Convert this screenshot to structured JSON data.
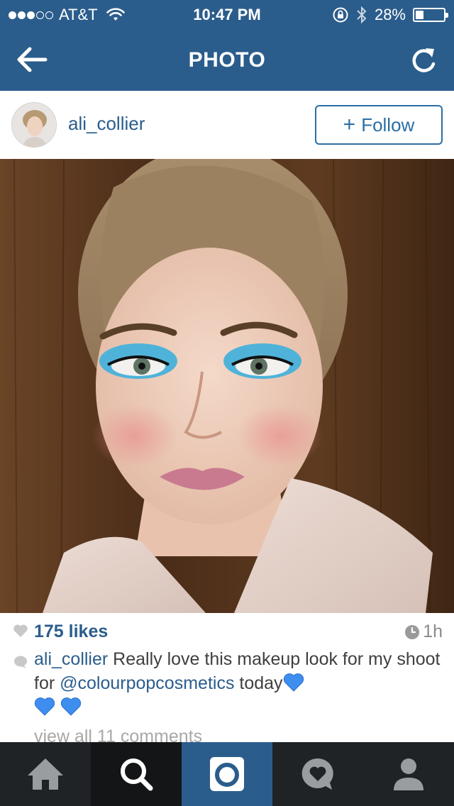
{
  "status_bar": {
    "carrier": "AT&T",
    "time": "10:47 PM",
    "battery_percent": "28%",
    "battery_level": 0.28,
    "signal_bars_filled": 3,
    "signal_bars_total": 5
  },
  "nav": {
    "title": "PHOTO",
    "back_icon": "back-arrow-icon",
    "refresh_icon": "refresh-icon"
  },
  "post": {
    "username": "ali_collier",
    "follow_label": "Follow",
    "follow_plus": "+",
    "likes": "175 likes",
    "time_ago": "1h",
    "caption_user": "ali_collier",
    "caption_text_1": " Really love this makeup look for my shoot for ",
    "caption_mention": "@colourpopcosmetics",
    "caption_text_2": " today",
    "view_comments": "view all 11 comments"
  },
  "tabbar": {
    "items": [
      {
        "name": "home",
        "icon": "home-icon"
      },
      {
        "name": "explore",
        "icon": "search-icon"
      },
      {
        "name": "camera",
        "icon": "camera-icon"
      },
      {
        "name": "activity",
        "icon": "activity-heart-bubble-icon"
      },
      {
        "name": "profile",
        "icon": "profile-icon"
      }
    ]
  },
  "colors": {
    "brand_blue": "#2b5d8c",
    "link_blue": "#2b6ea5",
    "tabbar_bg": "#1f2326",
    "heart_emoji_blue": "#3e8ef0"
  }
}
